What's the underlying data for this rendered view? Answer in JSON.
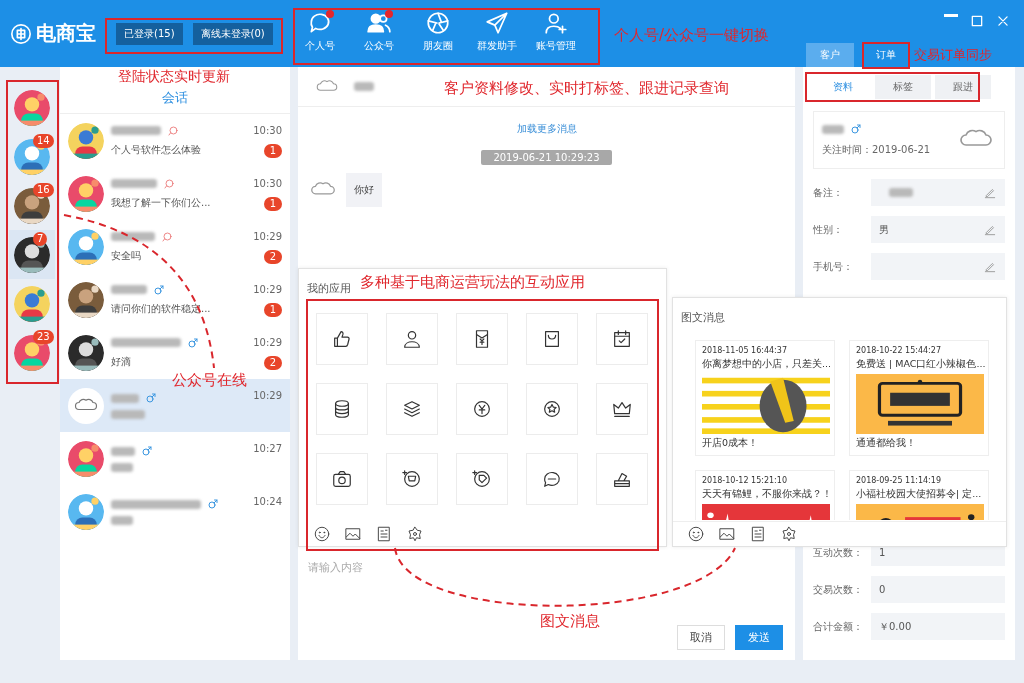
{
  "header": {
    "logo": "电商宝",
    "status_buttons": [
      "已登录(15)",
      "离线未登录(0)"
    ],
    "nav": [
      {
        "label": "个人号",
        "kind": "chat",
        "dot": true
      },
      {
        "label": "公众号",
        "kind": "users",
        "dot": true
      },
      {
        "label": "朋友圈",
        "kind": "aperture",
        "dot": false
      },
      {
        "label": "群发助手",
        "kind": "send",
        "dot": false
      },
      {
        "label": "账号管理",
        "kind": "user-add",
        "dot": false
      }
    ],
    "right_tabs": [
      {
        "label": "客户",
        "selected": true
      },
      {
        "label": "订单",
        "selected": false
      }
    ]
  },
  "accounts": [
    {
      "selected": false
    },
    {
      "badge": "14",
      "selected": false
    },
    {
      "badge": "16",
      "selected": false
    },
    {
      "badge": "7",
      "selected": true
    },
    {
      "selected": false
    },
    {
      "badge": "23",
      "selected": false
    }
  ],
  "conversations": {
    "title": "会话",
    "items": [
      {
        "kind": "chat",
        "time": "10:30",
        "preview": "个人号软件怎么体验",
        "unread": "1",
        "selected": false
      },
      {
        "kind": "chat",
        "time": "10:30",
        "preview": "我想了解一下你们公...",
        "unread": "1",
        "selected": false
      },
      {
        "kind": "chat",
        "time": "10:29",
        "preview": "安全吗",
        "unread": "2",
        "selected": false
      },
      {
        "kind": "male",
        "time": "10:29",
        "preview": "请问你们的软件稳定...",
        "unread": "1",
        "selected": false
      },
      {
        "kind": "male",
        "time": "10:29",
        "preview": "好滴",
        "unread": "2",
        "selected": false
      },
      {
        "kind": "male",
        "time": "10:29",
        "selected": true
      },
      {
        "kind": "male",
        "time": "10:27",
        "selected": false
      },
      {
        "kind": "male",
        "time": "10:24",
        "selected": false
      }
    ]
  },
  "chat": {
    "load_more": "加载更多消息",
    "timestamp": "2019-06-21 10:29:23",
    "messages": [
      {
        "text": "你好"
      }
    ],
    "input": {
      "placeholder": "请输入内容"
    },
    "buttons": [
      {
        "label": "取消",
        "kind": "secondary"
      },
      {
        "label": "发送",
        "kind": "primary"
      }
    ]
  },
  "apps_panel": {
    "title": "我的应用",
    "apps": [
      {
        "kind": "like"
      },
      {
        "kind": "user"
      },
      {
        "kind": "envelope"
      },
      {
        "kind": "bag"
      },
      {
        "kind": "calendar"
      },
      {
        "kind": "coins"
      },
      {
        "kind": "layers"
      },
      {
        "kind": "yen"
      },
      {
        "kind": "medal"
      },
      {
        "kind": "crown"
      },
      {
        "kind": "camera"
      },
      {
        "kind": "cart"
      },
      {
        "kind": "tag"
      },
      {
        "kind": "bubble"
      },
      {
        "kind": "ballot"
      }
    ]
  },
  "articles_panel": {
    "title": "图文消息",
    "articles": [
      {
        "date": "2018-11-05 16:44:37",
        "title": "你离梦想中的小店，只差关...",
        "footer": "开店0成本！",
        "kind": "stripes"
      },
      {
        "date": "2018-10-22 15:44:27",
        "title": "免费送 | MAC口红小辣椒色...",
        "footer": "通通都给我！",
        "kind": "board"
      },
      {
        "date": "2018-10-12 15:21:10",
        "title": "天天有锦鲤，不服你来战？！",
        "kind": "red"
      },
      {
        "date": "2018-09-25 11:14:19",
        "title": "小福社校园大使招募令| 定...",
        "kind": "orange"
      }
    ]
  },
  "profile": {
    "tabs": [
      {
        "label": "资料",
        "selected": true
      },
      {
        "label": "标签",
        "selected": false
      },
      {
        "label": "跟进",
        "selected": false
      }
    ],
    "follow_time": "关注时间：2019-06-21",
    "fields": [
      {
        "label": "备注：",
        "kind": "blurred",
        "editable": true
      },
      {
        "label": "性别：",
        "kind": "text",
        "value": "男",
        "editable": true
      },
      {
        "label": "手机号：",
        "kind": "empty",
        "editable": true
      }
    ],
    "stats": [
      {
        "label": "互动次数：",
        "kind": "text",
        "value": "1",
        "editable": false
      },
      {
        "label": "交易次数：",
        "kind": "text",
        "value": "0",
        "editable": false
      },
      {
        "label": "合计金额：",
        "kind": "text",
        "value": "￥0.00",
        "editable": false
      }
    ]
  },
  "annotations": [
    "个人号/公众号一键切换",
    "交易订单同步",
    "登陆状态实时更新",
    "客户资料修改、实时打标签、跟进记录查询",
    "公众号在线",
    "多种基于电商运营玩法的互动应用",
    "图文消息"
  ]
}
